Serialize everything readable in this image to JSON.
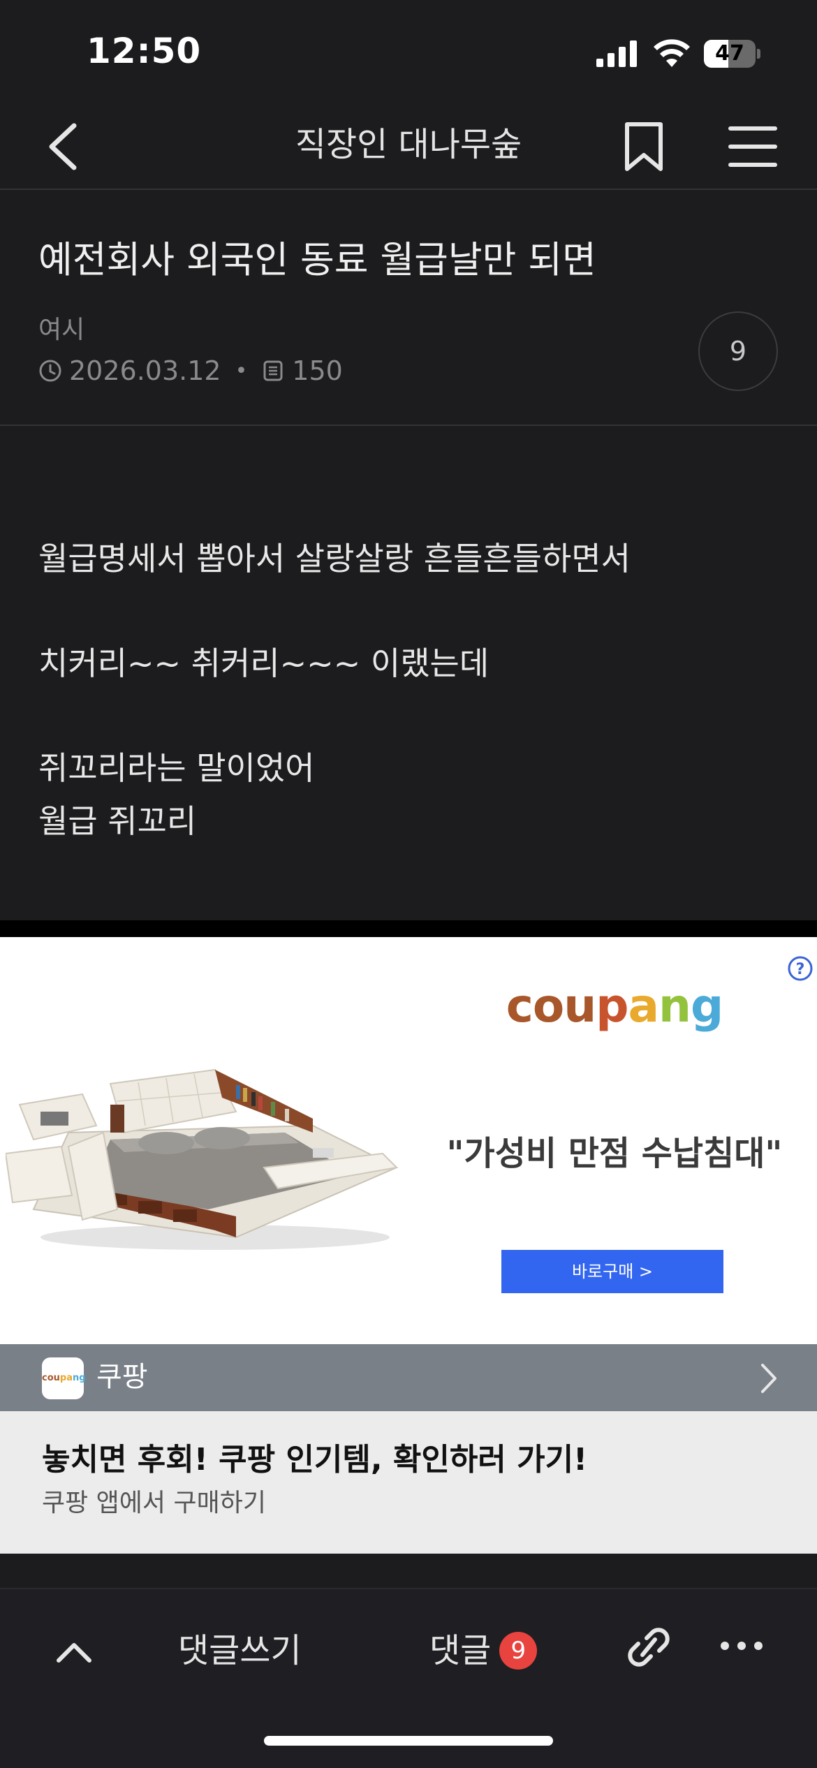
{
  "status_bar": {
    "time": "12:50",
    "battery_level": "47",
    "battery_fraction": 0.47
  },
  "nav": {
    "title": "직장인 대나무숲",
    "back_icon": "chevron-left-icon",
    "bookmark_icon": "bookmark-icon",
    "menu_icon": "hamburger-menu-icon"
  },
  "post": {
    "title": "예전회사 외국인 동료 월급날만 되면",
    "author": "여시",
    "date": "2026.03.12",
    "views": "150",
    "comment_count": "9",
    "body_lines": [
      "월급명세서 뽑아서 살랑살랑 흔들흔들하면서",
      "치커리~~ 취커리~~~ 이랬는데",
      "쥐꼬리라는 말이었어",
      "월급 쥐꼬리"
    ]
  },
  "ad": {
    "brand": "coupang",
    "brand_colors": [
      "#a8572b",
      "#c8542e",
      "#e8a92c",
      "#f3c23a",
      "#93c23d",
      "#4caad8"
    ],
    "headline": "\"가성비 만점 수납침대\"",
    "cta": "바로구매 >",
    "advertiser_name": "쿠팡",
    "advertiser_logo_text": "coupang",
    "footer_title": "놓치면 후회! 쿠팡 인기템, 확인하러 가기!",
    "footer_sub": "쿠팡 앱에서 구매하기"
  },
  "toolbar": {
    "write_comment": "댓글쓰기",
    "comments_label": "댓글",
    "comments_badge": "9",
    "accent": "#e8433e"
  }
}
